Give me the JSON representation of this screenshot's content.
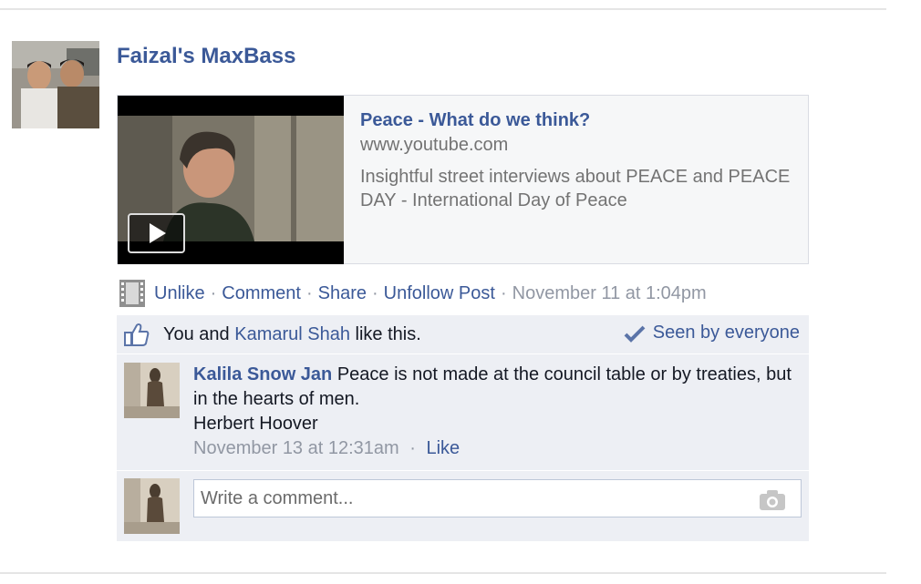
{
  "post": {
    "author": "Faizal's MaxBass",
    "link": {
      "title": "Peace - What do we think?",
      "domain": "www.youtube.com",
      "description": "Insightful street interviews about PEACE and PEACE DAY - International Day of Peace"
    },
    "actions": {
      "unlike": "Unlike",
      "comment": "Comment",
      "share": "Share",
      "unfollow": "Unfollow Post",
      "separator": "·",
      "timestamp": "November 11 at 1:04pm"
    }
  },
  "likes": {
    "prefix": "You and ",
    "friend": "Kamarul Shah",
    "suffix": " like this.",
    "seen": "Seen by everyone"
  },
  "comments": [
    {
      "author": "Kalila Snow Jan",
      "text_line1": " Peace is not made at the council table or by treaties, but in the hearts of men.",
      "text_line2": "Herbert Hoover",
      "timestamp": "November 13 at 12:31am",
      "separator": "·",
      "like": "Like"
    }
  ],
  "composer": {
    "placeholder": "Write a comment..."
  },
  "colors": {
    "link": "#3b5998",
    "ufi_background": "#edeff4",
    "meta": "#9197a3"
  },
  "icons": [
    "film-icon",
    "thumbs-up-icon",
    "check-icon",
    "camera-icon",
    "play-icon"
  ]
}
